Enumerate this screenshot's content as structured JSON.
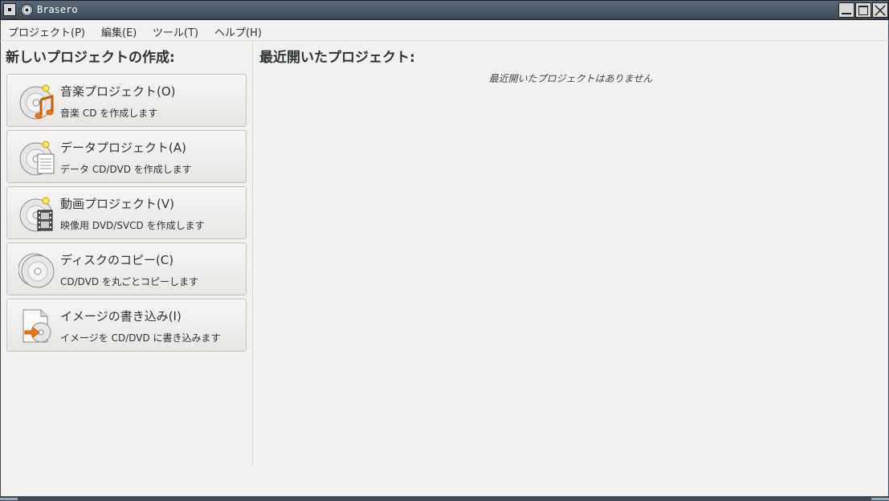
{
  "window": {
    "title": "Brasero"
  },
  "menubar": {
    "items": [
      {
        "label": "プロジェクト(P)"
      },
      {
        "label": "編集(E)"
      },
      {
        "label": "ツール(T)"
      },
      {
        "label": "ヘルプ(H)"
      }
    ]
  },
  "new_project": {
    "heading": "新しいプロジェクトの作成:",
    "buttons": [
      {
        "title": "音楽プロジェクト(O)",
        "desc": "音楽  CD を作成します",
        "icon": "audio-cd-icon"
      },
      {
        "title": "データプロジェクト(A)",
        "desc": "データ  CD/DVD を作成します",
        "icon": "data-disc-icon"
      },
      {
        "title": "動画プロジェクト(V)",
        "desc": "映像用  DVD/SVCD を作成します",
        "icon": "video-disc-icon"
      },
      {
        "title": "ディスクのコピー(C)",
        "desc": "CD/DVD を丸ごとコピーします",
        "icon": "disc-copy-icon"
      },
      {
        "title": "イメージの書き込み(I)",
        "desc": "イメージを  CD/DVD に書き込みます",
        "icon": "image-burn-icon"
      }
    ]
  },
  "recent": {
    "heading": "最近開いたプロジェクト:",
    "empty_message": "最近開いたプロジェクトはありません"
  },
  "colors": {
    "titlebar": "#3d4a56",
    "background": "#f2f1f0",
    "accent_orange": "#f57900"
  }
}
